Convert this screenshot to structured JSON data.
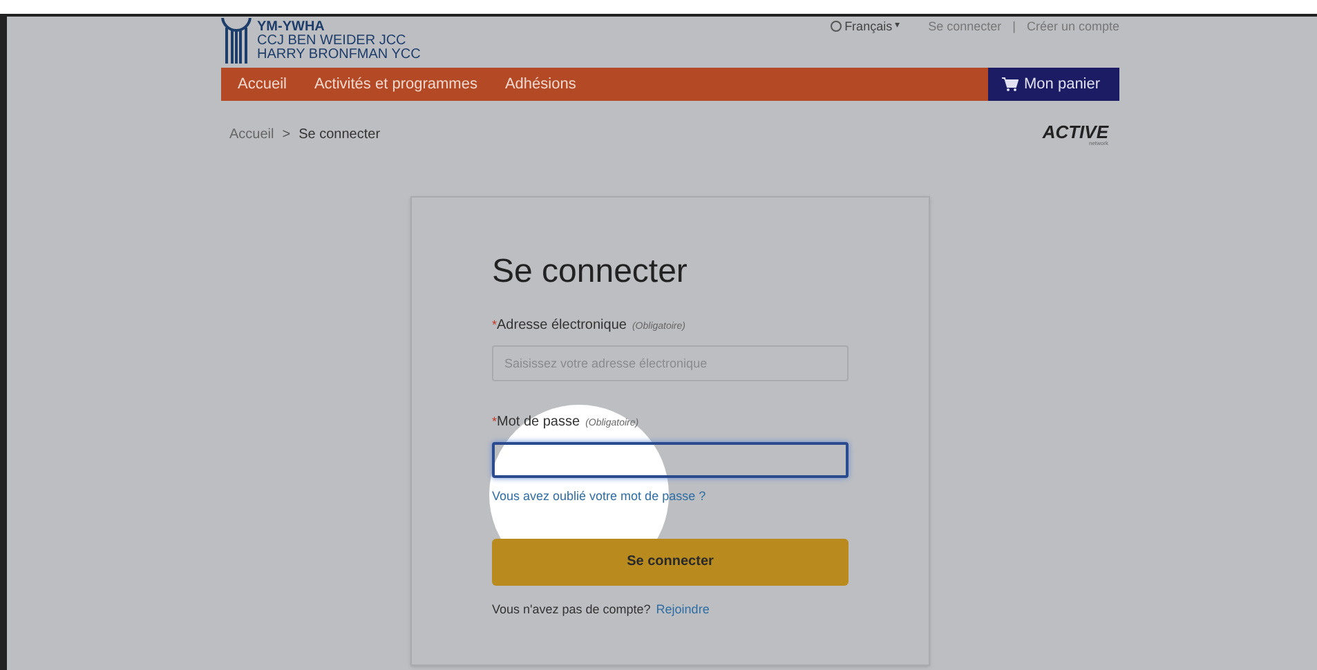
{
  "header": {
    "logo_lines": [
      "YM-YWHA",
      "CCJ BEN WEIDER JCC",
      "HARRY BRONFMAN YCC"
    ],
    "language": "Français",
    "language_caret": "▾",
    "top_links": [
      "Se connecter",
      "Créer un compte"
    ],
    "separator": "|"
  },
  "nav": {
    "items": [
      "Accueil",
      "Activités et programmes",
      "Adhésions"
    ],
    "cart": "Mon panier"
  },
  "breadcrumb": {
    "items": [
      "Accueil",
      "Se connecter"
    ],
    "separator": ">"
  },
  "partner_logo": {
    "text": "ACTIVE",
    "subtext": "network"
  },
  "form": {
    "title": "Se connecter",
    "fields": [
      {
        "label": "Adresse électronique",
        "required_mark": "*",
        "hint": "(Obligatoire)",
        "placeholder": "Saisissez votre adresse électronique",
        "focused": false
      },
      {
        "label": "Mot de passe",
        "required_mark": "*",
        "hint": "(Obligatoire)",
        "focused": true
      }
    ],
    "forgot_link": "Vous avez oublié votre mot de passe ?",
    "submit": "Se connecter",
    "signup_text": "Vous n'avez pas de compte?",
    "signup_link": "Rejoindre"
  }
}
